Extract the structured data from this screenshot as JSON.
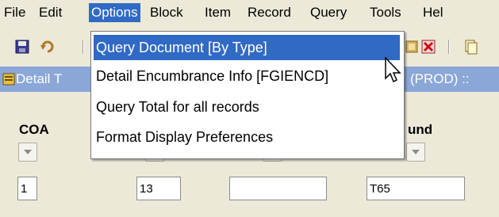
{
  "menubar": {
    "items": [
      {
        "label": "File"
      },
      {
        "label": "Edit"
      },
      {
        "label": "Options"
      },
      {
        "label": "Block"
      },
      {
        "label": "Item"
      },
      {
        "label": "Record"
      },
      {
        "label": "Query"
      },
      {
        "label": "Tools"
      },
      {
        "label": "Hel"
      }
    ],
    "active": "Options"
  },
  "title": {
    "left": "Detail T",
    "right": "(PROD) ::"
  },
  "dropdown": {
    "options": [
      {
        "label": "Query Document [By Type]"
      },
      {
        "label": "Detail Encumbrance Info [FGIENCD]"
      },
      {
        "label": "Query Total for all records"
      },
      {
        "label": "Format Display Preferences"
      }
    ]
  },
  "form": {
    "headers": {
      "coa": "COA",
      "fund": "und"
    },
    "fields": {
      "coa": "1",
      "second": "13",
      "third": "",
      "fund": "T65"
    }
  },
  "colors": {
    "highlight": "#316ac5",
    "background": "#ece9d8",
    "title_bar": "#8aa7d8"
  }
}
